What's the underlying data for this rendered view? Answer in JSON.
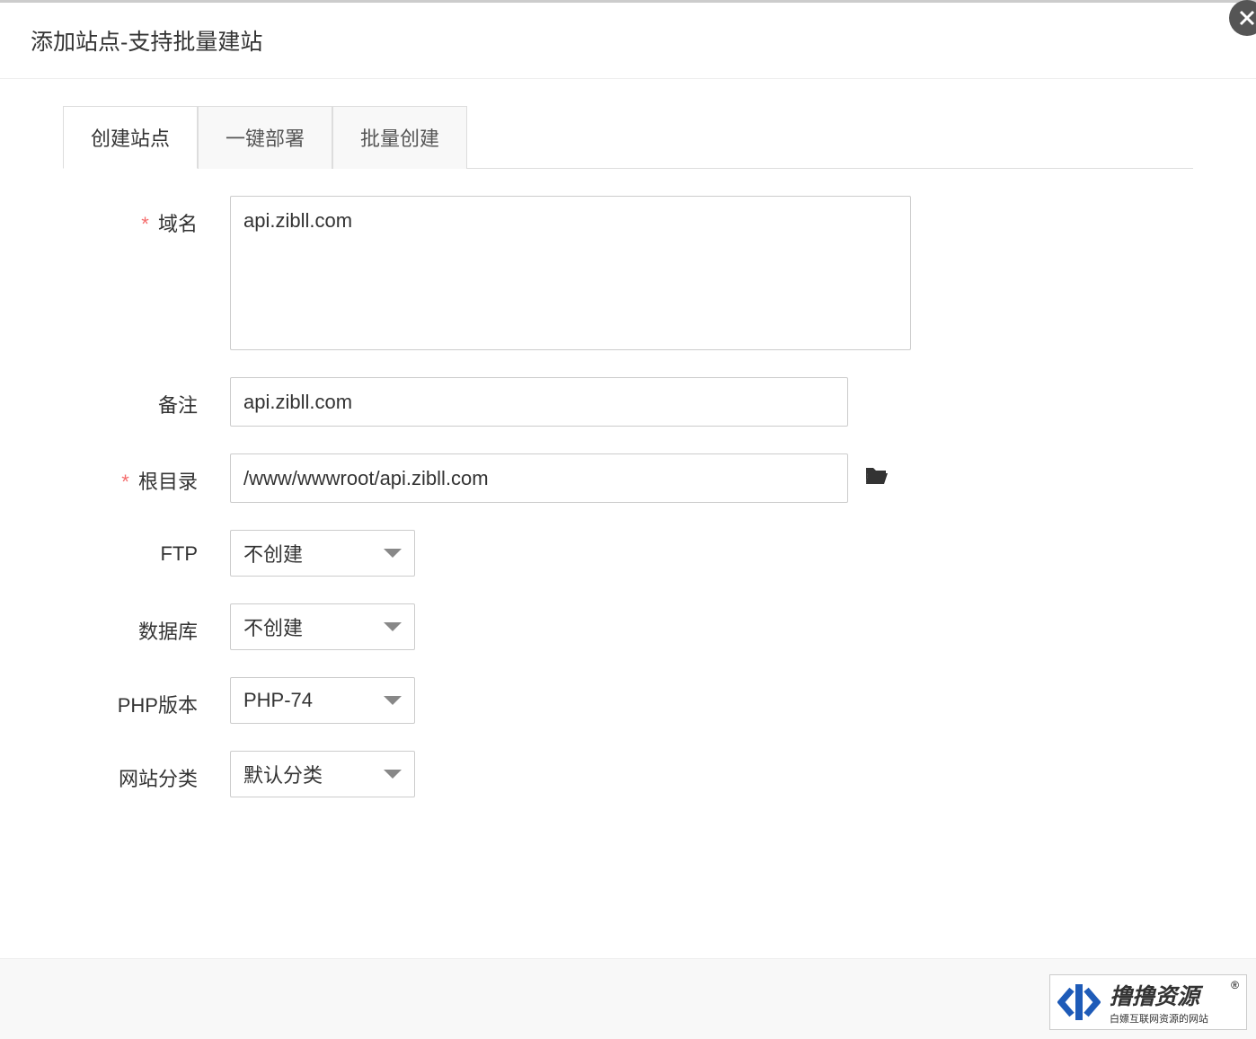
{
  "modal": {
    "title": "添加站点-支持批量建站",
    "tabs": [
      {
        "label": "创建站点",
        "active": true
      },
      {
        "label": "一键部署",
        "active": false
      },
      {
        "label": "批量创建",
        "active": false
      }
    ]
  },
  "form": {
    "domain": {
      "label": "域名",
      "value": "api.zibll.com",
      "required": true
    },
    "remark": {
      "label": "备注",
      "value": "api.zibll.com",
      "required": false
    },
    "root": {
      "label": "根目录",
      "value": "/www/wwwroot/api.zibll.com",
      "required": true
    },
    "ftp": {
      "label": "FTP",
      "selected": "不创建"
    },
    "database": {
      "label": "数据库",
      "selected": "不创建"
    },
    "php": {
      "label": "PHP版本",
      "selected": "PHP-74"
    },
    "category": {
      "label": "网站分类",
      "selected": "默认分类"
    }
  },
  "watermark": {
    "main": "撸撸资源",
    "sub": "白嫖互联网资源的网站"
  }
}
